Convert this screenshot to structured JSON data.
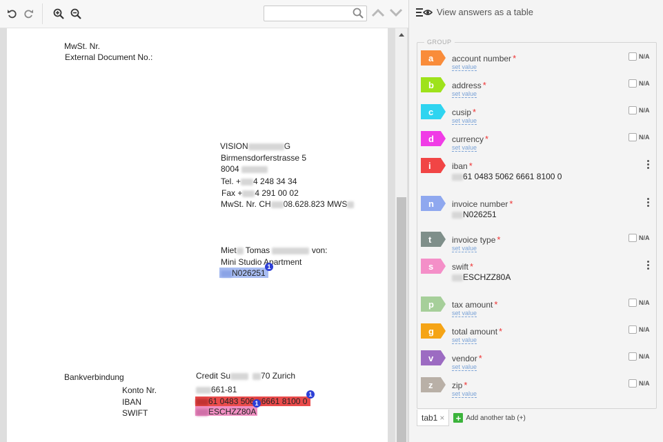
{
  "toolbar": {
    "search_placeholder": "",
    "icons": [
      "undo-icon",
      "redo-icon",
      "zoom-in-icon",
      "zoom-out-icon",
      "search-icon",
      "chevron-up-icon",
      "chevron-down-icon"
    ]
  },
  "document": {
    "mwst_label": "MwSt. Nr.",
    "ext_doc_label": "External Document No.:",
    "vendor_name_a": "VISION",
    "vendor_name_b": "G",
    "vendor_street": "Birmensdorferstrasse 5",
    "vendor_zip": "8004",
    "tel_a": "Tel. +",
    "tel_b": "4 248 34 34",
    "fax_a": "Fax +",
    "fax_b": "4 291 00 02",
    "vat_a": "MwSt. Nr. CH",
    "vat_b": "08.628.823 MWS",
    "tenant_a": "Miet",
    "tenant_b": "Tomas",
    "tenant_c": "von:",
    "apartment": "Mini Studio Apartment",
    "invoice_no": "N026251",
    "bank_label": "Bankverbindung",
    "bank_a": "Credit Su",
    "bank_b": "70 Zurich",
    "konto_label": "Konto Nr.",
    "konto_value": "661-81",
    "iban_label": "IBAN",
    "iban_a": "61 0483 506",
    "iban_b": "6661 8100 0",
    "swift_label": "SWIFT",
    "swift_value": "ESCHZZ80A",
    "badge": "1"
  },
  "panel": {
    "view_table": "View answers as a table",
    "group_label": "GROUP",
    "set_value": "set value",
    "na_label": "N/A",
    "required_mark": "*",
    "fields": [
      {
        "letter": "a",
        "name": "account number",
        "color": "#f98c3a"
      },
      {
        "letter": "b",
        "name": "address",
        "color": "#9ee21b"
      },
      {
        "letter": "c",
        "name": "cusip",
        "color": "#2fd4f0"
      },
      {
        "letter": "d",
        "name": "currency",
        "color": "#f03ce6"
      },
      {
        "letter": "i",
        "name": "iban",
        "color": "#f14545",
        "value": "61 0483 5062 6661 8100 0"
      },
      {
        "letter": "n",
        "name": "invoice number",
        "color": "#8fa8ef",
        "value": "N026251"
      },
      {
        "letter": "t",
        "name": "invoice type",
        "color": "#7f8f8a"
      },
      {
        "letter": "s",
        "name": "swift",
        "color": "#f48fc8",
        "value": "ESCHZZ80A"
      },
      {
        "letter": "p",
        "name": "tax amount",
        "color": "#a6cf9a"
      },
      {
        "letter": "g",
        "name": "total amount",
        "color": "#f5a416"
      },
      {
        "letter": "v",
        "name": "vendor",
        "color": "#9c6bc2"
      },
      {
        "letter": "z",
        "name": "zip",
        "color": "#b9b0a7"
      }
    ],
    "tab_name": "tab1",
    "tab_close": "×",
    "add_tab": "Add another tab (+)",
    "add_symbol": "+"
  }
}
